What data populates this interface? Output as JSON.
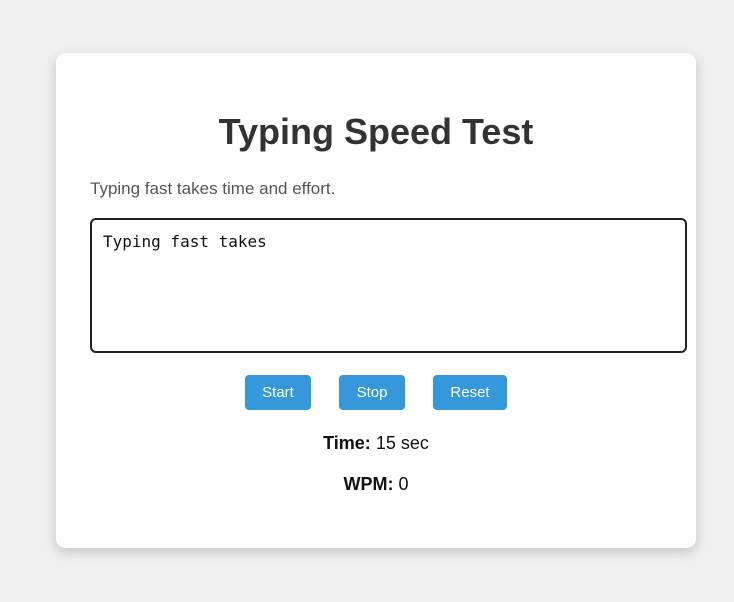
{
  "app": {
    "title": "Typing Speed Test",
    "prompt_text": "Typing fast takes time and effort."
  },
  "input": {
    "value": "Typing fast takes",
    "placeholder": ""
  },
  "controls": {
    "start_label": "Start",
    "stop_label": "Stop",
    "reset_label": "Reset"
  },
  "stats": {
    "time_label": "Time:",
    "time_value": "15 sec",
    "wpm_label": "WPM:",
    "wpm_value": "0"
  },
  "colors": {
    "accent": "#3498db",
    "background": "#f0f0f0",
    "card": "#ffffff",
    "title": "#333333"
  }
}
